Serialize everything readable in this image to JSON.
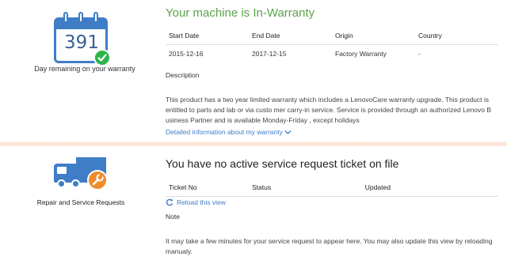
{
  "warranty": {
    "days_remaining": "391",
    "caption": "Day remaining on your warranty",
    "title": "Your machine is In-Warranty",
    "table": {
      "headers": [
        "Start Date",
        "End Date",
        "Origin",
        "Country"
      ],
      "row": [
        "2015-12-16",
        "2017-12-15",
        "Factory Warranty",
        "-"
      ]
    },
    "description_label": "Description",
    "description_text": "This product has a two year limited warranty which includes a LenovoCare warranty upgrade. This product is entitled to parts and lab or via custo mer carry-in service. Service is provided through an authorized Lenovo B usiness Partner and is available Monday-Friday , except holidays",
    "detail_link": "Detailed information about my warranty",
    "icons": {
      "calendar": "calendar-icon",
      "check": "check-circle-icon",
      "chevron": "chevron-down-icon"
    },
    "colors": {
      "title_green": "#5aa24a",
      "accent_blue": "#3f7dc7",
      "check_green": "#2db34a"
    }
  },
  "service": {
    "caption": "Repair and Service Requests",
    "title": "You have no active service request ticket on file",
    "table": {
      "headers": [
        "Ticket No",
        "Status",
        "Updated"
      ]
    },
    "reload_label": "Reload this view",
    "note_label": "Note",
    "note_text": "It may take a few minutes for your service request to appear here. You may also update this view by reloading manualy.",
    "icons": {
      "truck": "truck-icon",
      "wrench": "wrench-icon",
      "reload": "reload-icon"
    },
    "colors": {
      "wrench_orange": "#ef8c2b"
    }
  }
}
